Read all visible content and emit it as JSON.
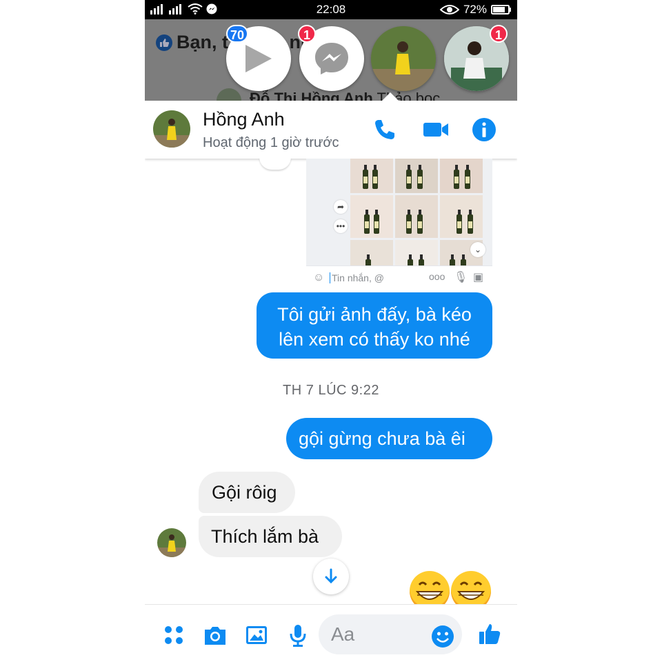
{
  "status_bar": {
    "time": "22:08",
    "battery": "72%"
  },
  "background": {
    "feed_title": "Bạn, t… H… nh",
    "feed_subtitle_name": "Đỗ Thị Hồng Anh",
    "feed_subtitle_rest": " Thảo bọc"
  },
  "chat_heads": [
    {
      "name": "video-head",
      "badge": "70",
      "badge_color": "#1877f2"
    },
    {
      "name": "messenger-head",
      "badge": "1",
      "badge_color": "#f02849"
    },
    {
      "name": "contact-head-1",
      "badge": ""
    },
    {
      "name": "contact-head-2",
      "badge": "1",
      "badge_color": "#f02849"
    }
  ],
  "header": {
    "name": "Hồng Anh",
    "status": "Hoạt động 1 giờ trước"
  },
  "embedded_screenshot": {
    "input_placeholder": "Tin nhắn, @"
  },
  "messages": [
    {
      "direction": "out",
      "text_line1": "Tôi gửi ảnh đấy, bà kéo",
      "text_line2": "lên xem có thấy ko nhé"
    },
    {
      "direction": "out",
      "text": "gội gừng chưa bà êi"
    },
    {
      "direction": "in",
      "text": "Gội rôig"
    },
    {
      "direction": "in",
      "text": "Thích lắm bà"
    }
  ],
  "timestamp": "TH 7 LÚC 9:22",
  "composer": {
    "placeholder": "Aa"
  },
  "colors": {
    "accent": "#0d8bf2",
    "incoming_bubble": "#f0f0f0",
    "badge_red": "#f02849",
    "badge_blue": "#1877f2"
  }
}
